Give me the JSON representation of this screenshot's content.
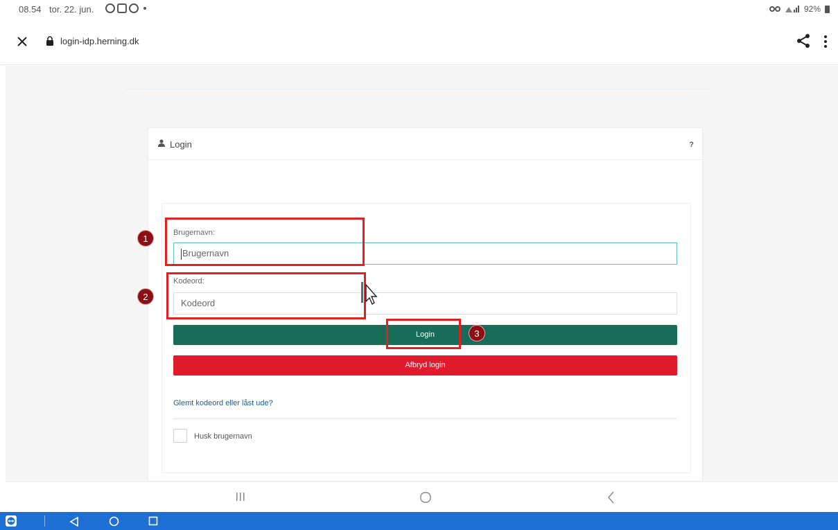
{
  "status_bar": {
    "time": "08.54",
    "date": "tor. 22. jun.",
    "battery": "92%"
  },
  "address_bar": {
    "url": "login-idp.herning.dk"
  },
  "login_card": {
    "title": "Login",
    "help": "?"
  },
  "form": {
    "username_label": "Brugernavn:",
    "username_placeholder": "Brugernavn",
    "password_label": "Kodeord:",
    "password_placeholder": "Kodeord",
    "login_button": "Login",
    "cancel_button": "Afbryd login",
    "forgot_link": "Glemt kodeord eller låst ude?",
    "remember_label": "Husk brugernavn"
  },
  "annotations": {
    "step1": "1",
    "step2": "2",
    "step3": "3"
  },
  "colors": {
    "login_green": "#176d58",
    "cancel_red": "#e01b2e",
    "annotation_red": "#e32020",
    "taskbar_blue": "#1d6fd3"
  }
}
